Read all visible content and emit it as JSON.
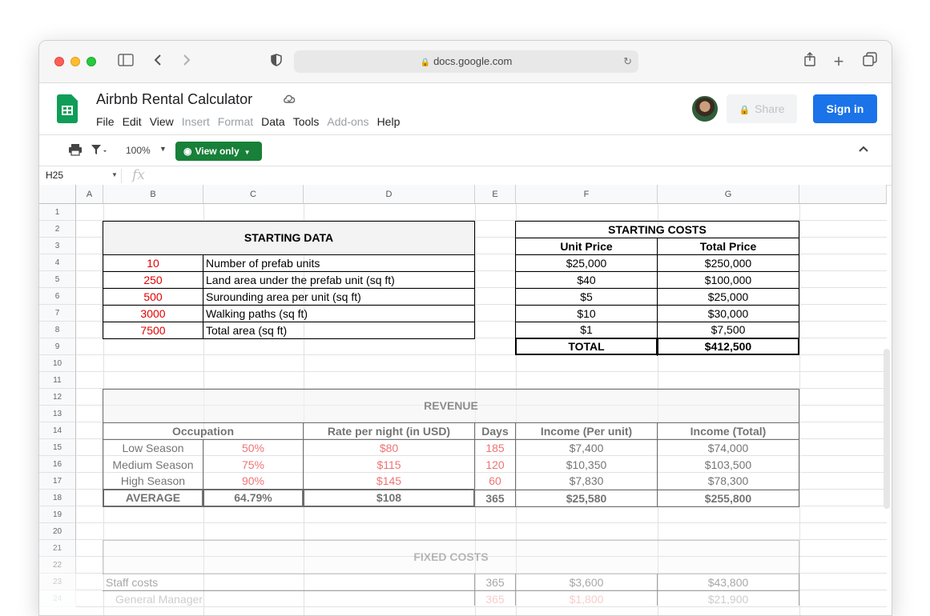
{
  "browser": {
    "url": "docs.google.com"
  },
  "app": {
    "title": "Airbnb Rental Calculator",
    "menu": [
      "File",
      "Edit",
      "View",
      "Insert",
      "Format",
      "Data",
      "Tools",
      "Add-ons",
      "Help"
    ],
    "menu_dim": [
      false,
      false,
      false,
      true,
      true,
      false,
      false,
      true,
      false
    ],
    "share_label": "Share",
    "signin_label": "Sign in",
    "zoom": "100%",
    "view_only_label": "View only",
    "cell_ref": "H25",
    "fx_label": "fx"
  },
  "columns": [
    "A",
    "B",
    "C",
    "D",
    "E",
    "F",
    "G"
  ],
  "rows": [
    "1",
    "2",
    "3",
    "4",
    "5",
    "6",
    "7",
    "8",
    "9",
    "10",
    "11",
    "12",
    "13",
    "14",
    "15",
    "16",
    "17",
    "18",
    "19",
    "20",
    "21",
    "22",
    "23",
    "24"
  ],
  "starting_data": {
    "title": "STARTING DATA",
    "items": [
      {
        "value": "10",
        "label": "Number of prefab units"
      },
      {
        "value": "250",
        "label": "Land area under the prefab unit (sq ft)"
      },
      {
        "value": "500",
        "label": "Surounding area per unit (sq ft)"
      },
      {
        "value": "3000",
        "label": "Walking paths (sq ft)"
      },
      {
        "value": "7500",
        "label": "Total area (sq ft)"
      }
    ]
  },
  "starting_costs": {
    "title": "STARTING COSTS",
    "col_unit": "Unit Price",
    "col_total": "Total Price",
    "rows": [
      {
        "unit": "$25,000",
        "total": "$250,000"
      },
      {
        "unit": "$40",
        "total": "$100,000"
      },
      {
        "unit": "$5",
        "total": "$25,000"
      },
      {
        "unit": "$10",
        "total": "$30,000"
      },
      {
        "unit": "$1",
        "total": "$7,500"
      }
    ],
    "total_label": "TOTAL",
    "total_value": "$412,500"
  },
  "revenue": {
    "title": "REVENUE",
    "headers": [
      "Occupation",
      "Rate per night (in USD)",
      "Days",
      "Income (Per unit)",
      "Income (Total)"
    ],
    "rows": [
      {
        "season": "Low Season",
        "occ": "50%",
        "rate": "$80",
        "days": "185",
        "per_unit": "$7,400",
        "total": "$74,000"
      },
      {
        "season": "Medium Season",
        "occ": "75%",
        "rate": "$115",
        "days": "120",
        "per_unit": "$10,350",
        "total": "$103,500"
      },
      {
        "season": "High Season",
        "occ": "90%",
        "rate": "$145",
        "days": "60",
        "per_unit": "$7,830",
        "total": "$78,300"
      }
    ],
    "average": {
      "label": "AVERAGE",
      "occ": "64.79%",
      "rate": "$108",
      "days": "365",
      "per_unit": "$25,580",
      "total": "$255,800"
    }
  },
  "fixed_costs": {
    "title": "FIXED COSTS",
    "rows": [
      {
        "label": "Staff costs",
        "days": "365",
        "per_unit": "$3,600",
        "total": "$43,800"
      },
      {
        "label": "General Manager",
        "days": "365",
        "per_unit": "$1,800",
        "total": "$21,900"
      }
    ]
  }
}
